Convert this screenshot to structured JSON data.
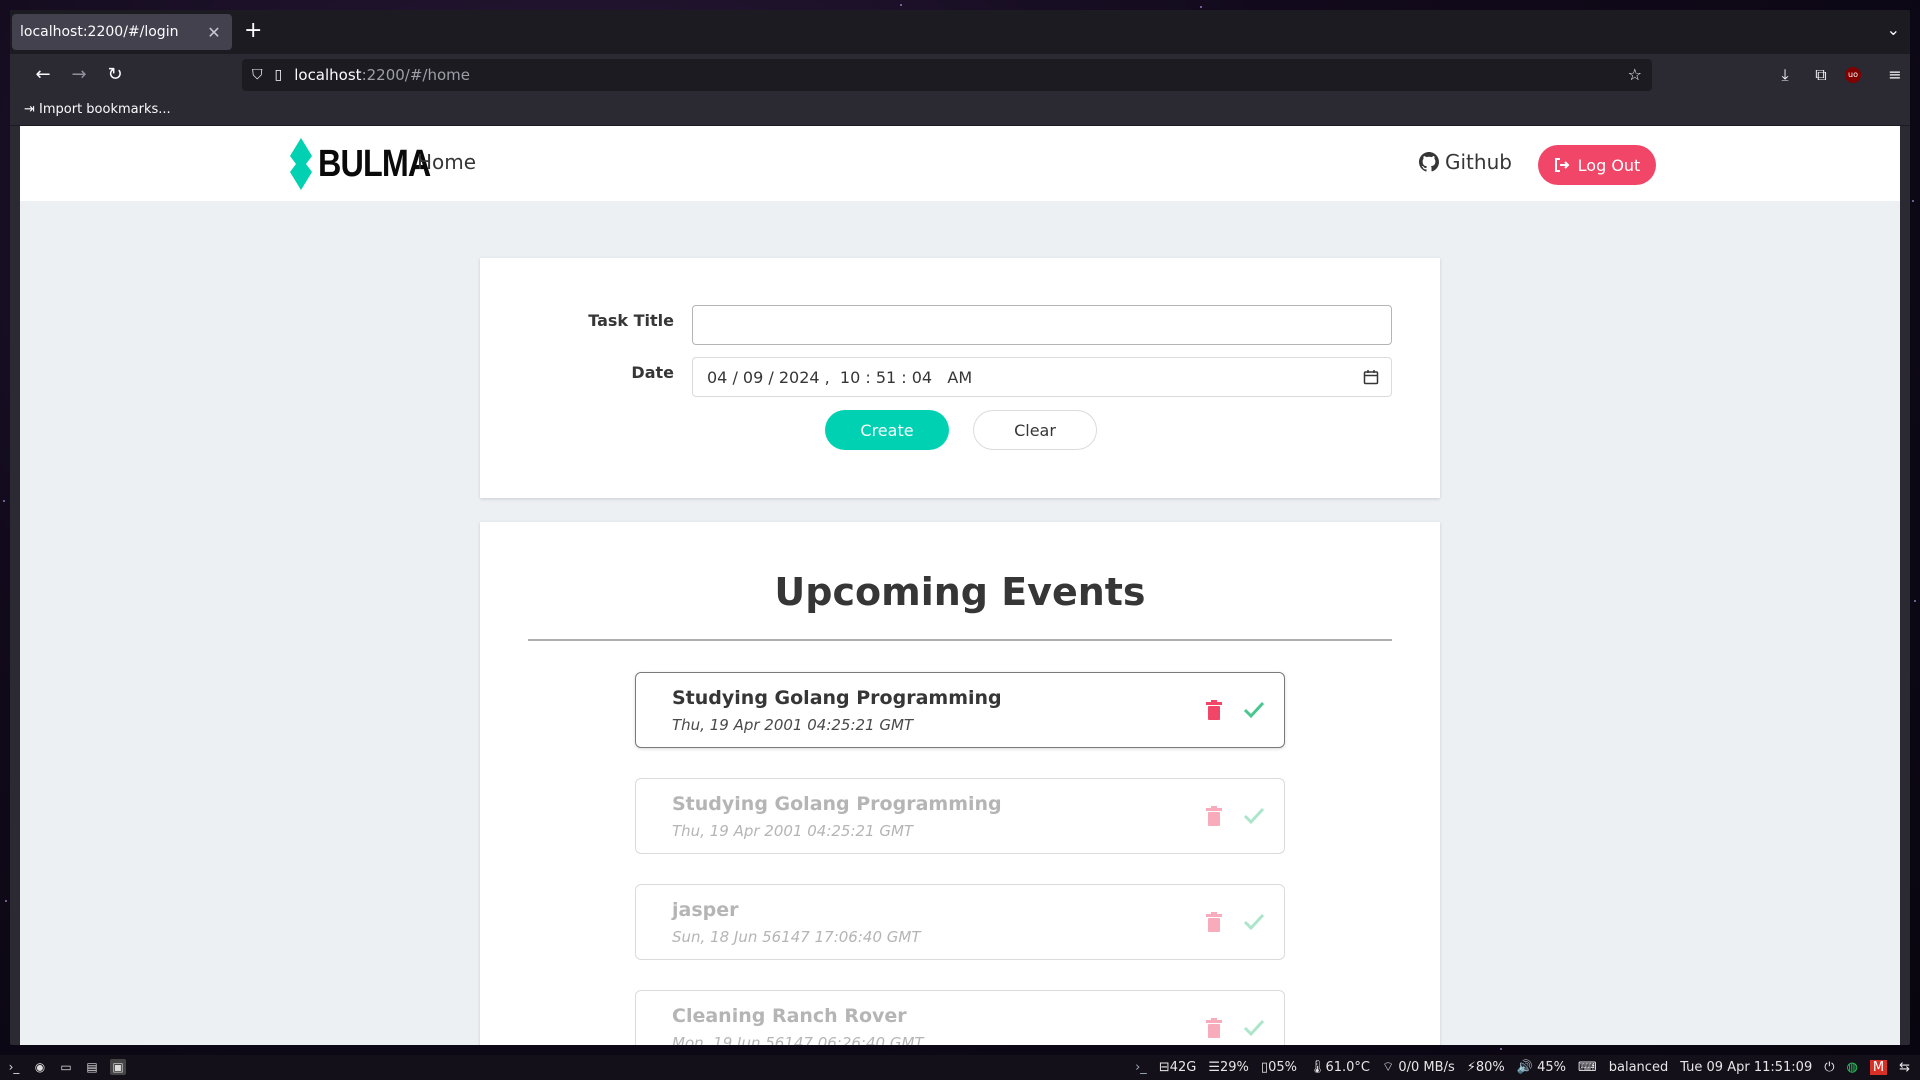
{
  "browser": {
    "tab_title": "localhost:2200/#/login",
    "url_host": "localhost",
    "url_path": ":2200/#/home",
    "bookmark_item": "Import bookmarks..."
  },
  "site": {
    "brand": "BULMA",
    "home_link": "Home",
    "github_link": "Github",
    "logout_label": "Log Out"
  },
  "form": {
    "task_title_label": "Task Title",
    "task_title_value": "",
    "date_label": "Date",
    "date_value": "04 / 09 / 2024 ,  10 : 51 : 04   AM",
    "create_label": "Create",
    "clear_label": "Clear"
  },
  "events": {
    "heading": "Upcoming Events",
    "items": [
      {
        "title": "Studying Golang Programming",
        "date": "Thu, 19 Apr 2001 04:25:21 GMT"
      },
      {
        "title": "Studying Golang Programming",
        "date": "Thu, 19 Apr 2001 04:25:21 GMT"
      },
      {
        "title": "jasper",
        "date": "Sun, 18 Jun 56147 17:06:40 GMT"
      },
      {
        "title": "Cleaning Ranch Rover",
        "date": "Mon, 19 Jun 56147 06:26:40 GMT"
      }
    ]
  },
  "taskbar": {
    "disk": "42G",
    "memory": "29%",
    "cpu": "05%",
    "temp": "61.0°C",
    "network": "0/0 MB/s",
    "battery": "80%",
    "volume": "45%",
    "power_profile": "balanced",
    "clock": "Tue 09 Apr 11:51:09"
  },
  "colors": {
    "primary": "#00d1b2",
    "danger": "#f14668",
    "success": "#48c78e"
  }
}
